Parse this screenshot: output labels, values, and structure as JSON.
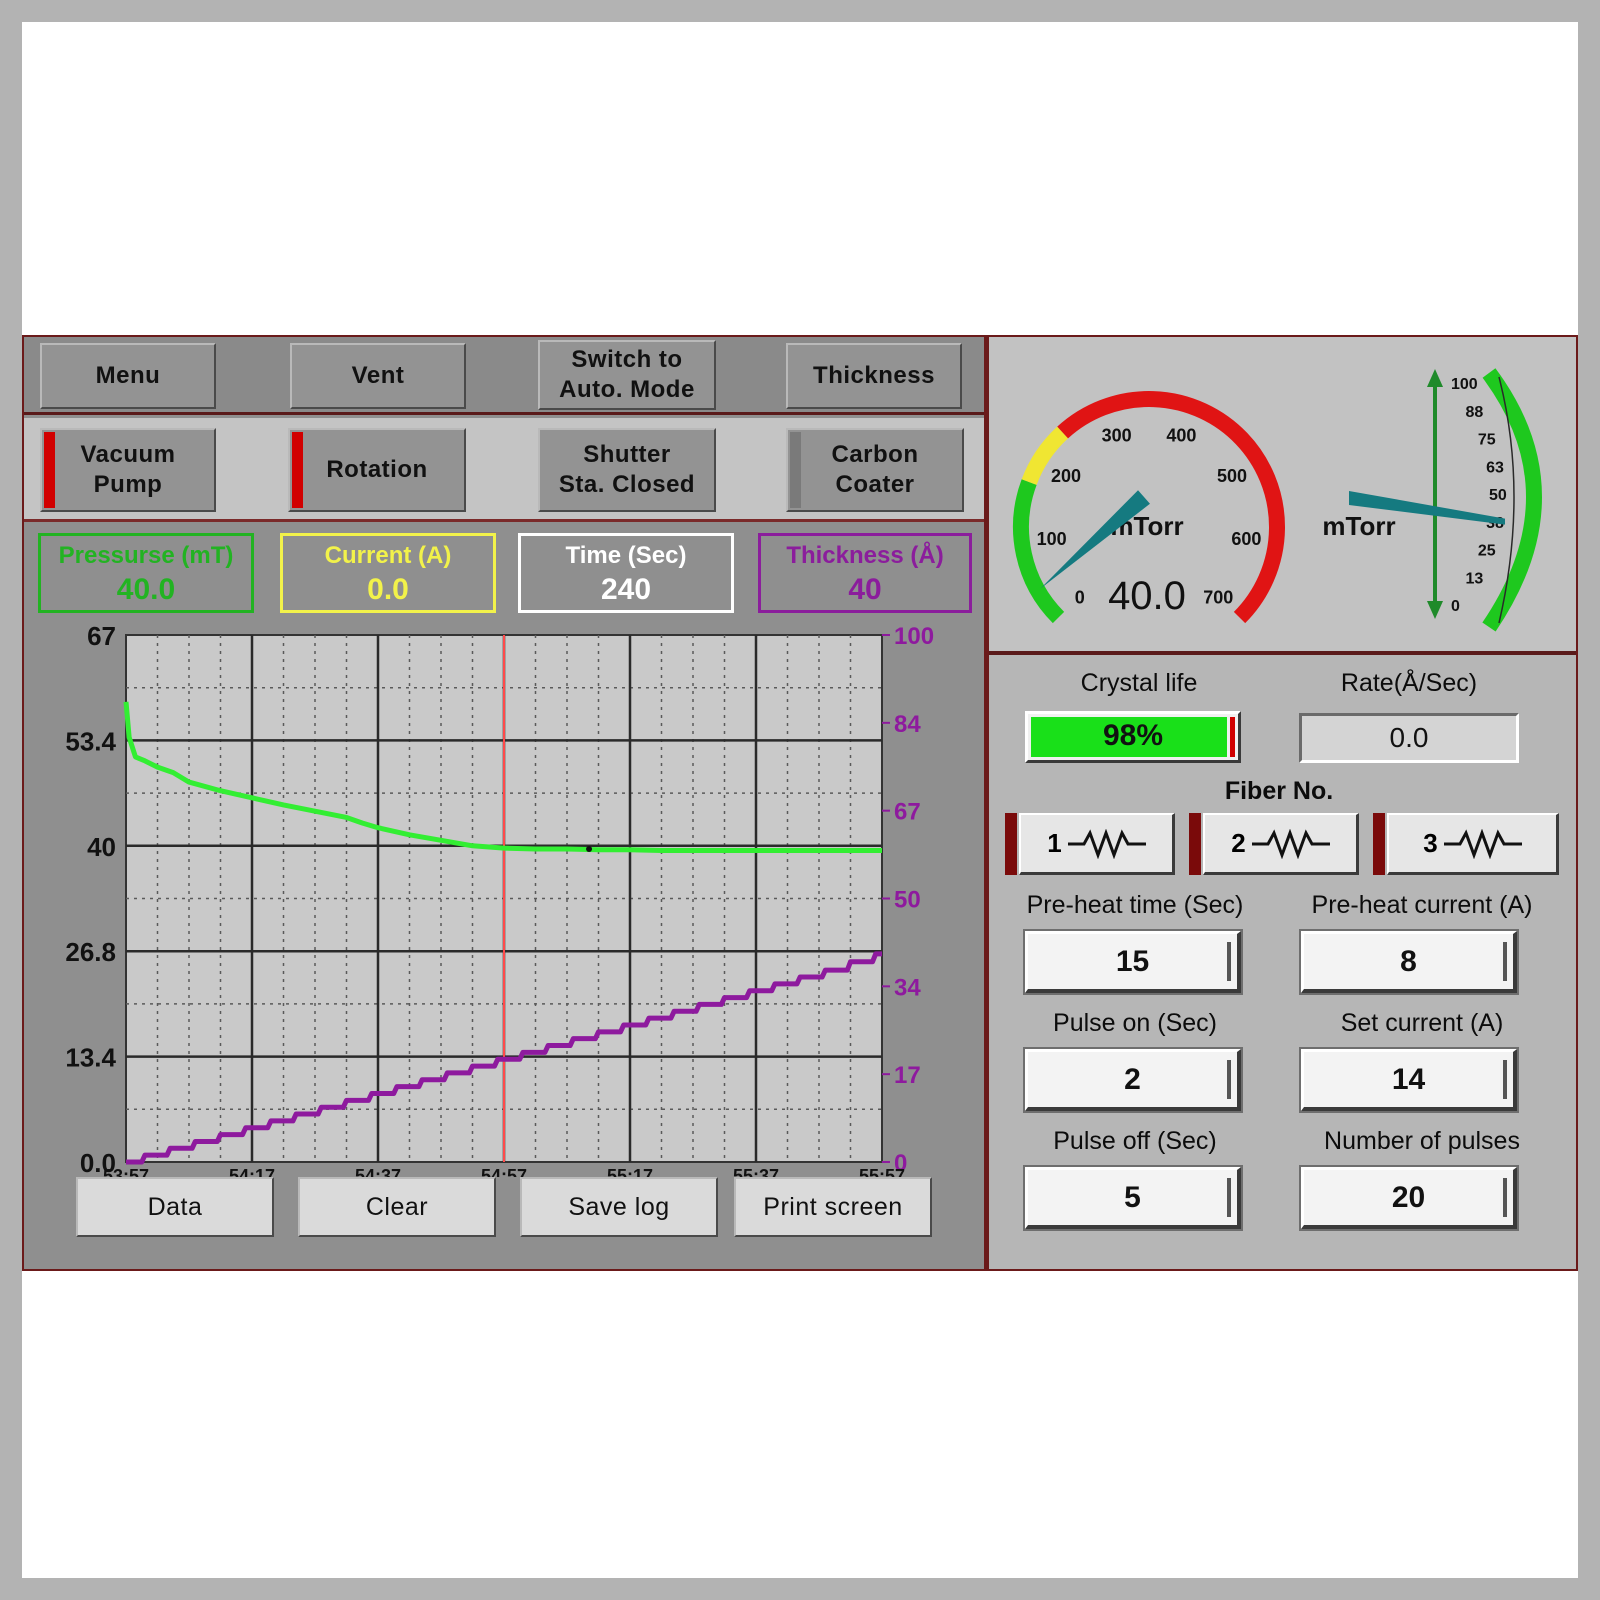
{
  "top_menu": {
    "menu": "Menu",
    "vent": "Vent",
    "auto_mode": "Switch to\nAuto. Mode",
    "thickness": "Thickness"
  },
  "toggles": {
    "vacuum_pump": "Vacuum\nPump",
    "rotation": "Rotation",
    "shutter": "Shutter\nSta. Closed",
    "carbon_coater": "Carbon\nCoater"
  },
  "readouts": {
    "pressure": {
      "label": "Pressurse (mT)",
      "value": "40.0",
      "color": "#22b322"
    },
    "current": {
      "label": "Current (A)",
      "value": "0.0",
      "color": "#f2f24a"
    },
    "time": {
      "label": "Time (Sec)",
      "value": "240",
      "color": "#ffffff"
    },
    "thickness": {
      "label": "Thickness (Å)",
      "value": "40",
      "color": "#8b1d9c"
    }
  },
  "chart_data": {
    "type": "line",
    "x_ticks": [
      "53:57",
      "54:17",
      "54:37",
      "54:57",
      "55:17",
      "55:37",
      "55:57"
    ],
    "y_left_ticks": [
      "67",
      "53.4",
      "40",
      "26.8",
      "13.4",
      "0.0"
    ],
    "y_right_ticks": [
      "100",
      "84",
      "67",
      "50",
      "34",
      "17",
      "0"
    ],
    "y_left_range": [
      0,
      67
    ],
    "y_right_range": [
      0,
      100
    ],
    "cursor_x": "54:57",
    "series": [
      {
        "axis": "left",
        "color": "#33ee33",
        "x": [
          0,
          1,
          3,
          6,
          10,
          15,
          20,
          30,
          40,
          50,
          60,
          70,
          75,
          80,
          90,
          100,
          110,
          120
        ],
        "y": [
          58.5,
          54,
          51.5,
          51,
          50.2,
          49.5,
          48.3,
          47.2,
          46.3,
          45.4,
          44.6,
          43.8,
          43.1,
          42.5,
          41.6,
          40.9,
          40.2,
          39.9
        ]
      },
      {
        "axis": "left",
        "color": "#33ee33",
        "x": [
          120,
          130,
          140,
          150,
          160,
          170,
          180,
          190,
          200,
          210,
          220,
          230,
          240
        ],
        "y": [
          39.9,
          39.8,
          39.8,
          39.7,
          39.7,
          39.6,
          39.6,
          39.6,
          39.6,
          39.6,
          39.6,
          39.6,
          39.6
        ]
      },
      {
        "axis": "right",
        "color": "#8e1a9e",
        "x": [
          0,
          8,
          16,
          24,
          32,
          40,
          48,
          56,
          64,
          72,
          80,
          88,
          96,
          104,
          112,
          120,
          128,
          136,
          144,
          152,
          160,
          168,
          176,
          184,
          192,
          200,
          208,
          216,
          224,
          232,
          240
        ],
        "y": [
          0,
          1.3,
          2.6,
          3.9,
          5.2,
          6.5,
          7.8,
          9.1,
          10.4,
          11.7,
          13,
          14.3,
          15.6,
          16.9,
          18.2,
          19.5,
          20.8,
          22.1,
          23.4,
          24.7,
          26,
          27.3,
          28.6,
          29.9,
          31.2,
          32.5,
          33.8,
          35.1,
          36.4,
          38,
          39.5
        ]
      }
    ]
  },
  "chart_buttons": {
    "data": "Data",
    "clear": "Clear",
    "save_log": "Save log",
    "print": "Print screen"
  },
  "gauge_pressure": {
    "unit": "mTorr",
    "value": "40.0",
    "value_num": 40,
    "ticks": [
      "0",
      "100",
      "200",
      "300",
      "400",
      "500",
      "600",
      "700"
    ]
  },
  "gauge_percent": {
    "unit": "mTorr",
    "ticks": [
      "100",
      "88",
      "75",
      "63",
      "50",
      "38",
      "25",
      "13",
      "0"
    ],
    "value_num": 38
  },
  "status": {
    "crystal_life_label": "Crystal life",
    "crystal_life_value": "98%",
    "crystal_life_fraction": 0.98,
    "rate_label": "Rate(Å/Sec)",
    "rate_value": "0.0",
    "fiber_label": "Fiber No.",
    "fibers": [
      "1",
      "2",
      "3"
    ]
  },
  "settings": {
    "preheat_time_label": "Pre-heat time (Sec)",
    "preheat_time_value": "15",
    "preheat_current_label": "Pre-heat current (A)",
    "preheat_current_value": "8",
    "pulse_on_label": "Pulse on (Sec)",
    "pulse_on_value": "2",
    "set_current_label": "Set current (A)",
    "set_current_value": "14",
    "pulse_off_label": "Pulse off (Sec)",
    "pulse_off_value": "5",
    "num_pulses_label": "Number of pulses",
    "num_pulses_value": "20"
  }
}
